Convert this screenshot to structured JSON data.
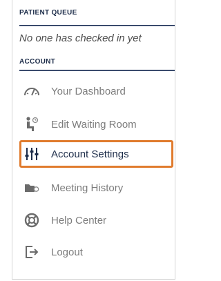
{
  "patient_queue": {
    "title": "PATIENT QUEUE",
    "empty_message": "No one has checked in yet"
  },
  "account": {
    "title": "ACCOUNT",
    "items": [
      {
        "label": "Your Dashboard",
        "icon": "gauge-icon"
      },
      {
        "label": "Edit Waiting Room",
        "icon": "waiting-room-icon"
      },
      {
        "label": "Account Settings",
        "icon": "sliders-icon",
        "active": true
      },
      {
        "label": "Meeting History",
        "icon": "camera-folder-icon"
      },
      {
        "label": "Help Center",
        "icon": "lifebuoy-icon"
      },
      {
        "label": "Logout",
        "icon": "logout-icon"
      }
    ]
  },
  "colors": {
    "highlight_border": "#e07b2d",
    "heading": "#1c2c49",
    "muted_text": "#7c7c7c"
  }
}
